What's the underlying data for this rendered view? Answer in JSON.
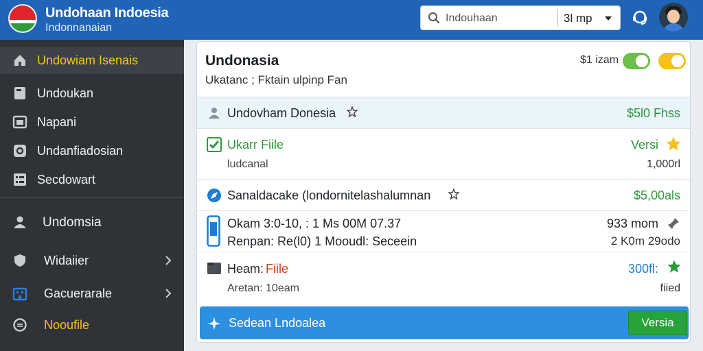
{
  "header": {
    "title": "Undohaan Indoesia",
    "subtitle": "Indonnanaian",
    "search": {
      "value": "Indouhaan",
      "selected": "3l mp"
    }
  },
  "sidebar": {
    "items": [
      {
        "label": "Undowiam Isenais",
        "icon": "home-icon",
        "active": true
      },
      {
        "label": "Undoukan",
        "icon": "document-icon"
      },
      {
        "label": "Napani",
        "icon": "image-icon"
      },
      {
        "label": "Undanfiadosian",
        "icon": "circle-icon"
      },
      {
        "label": "Secdowart",
        "icon": "list-icon"
      },
      {
        "label": "Undomsia",
        "icon": "user-icon"
      },
      {
        "label": "Widaiier",
        "icon": "shield-icon"
      },
      {
        "label": "Gacuerarale",
        "icon": "building-icon"
      },
      {
        "label": "Nooufile",
        "icon": "chat-icon"
      }
    ]
  },
  "main": {
    "title": "Undonasia",
    "subtitle": "Ukatanc ; Fktain ulpinp Fan",
    "status_label": "$1 izam",
    "rows": [
      {
        "title": "Undovham Donesia",
        "right": "$5l0 Fhss"
      },
      {
        "title": "Ukarr Fiile",
        "sub": "ludcanal",
        "right": "Versi",
        "right_sub": "1,000rl"
      },
      {
        "title": "Sanaldacake (londornitelashalumnan",
        "right": "$5,00als"
      },
      {
        "line1": "Okam 3:0-10, : 1 Ms 00M 07.37",
        "line2": "Renpan: Re(l0) 1 Mooudl: Seceein",
        "right1": "933 mom",
        "right2": "2 K0m 29odo"
      },
      {
        "title_a": "Heam:",
        "title_b": "Fiile",
        "sub": "Aretan: 10eam",
        "right": "300fl:",
        "right_sub": "fiied"
      }
    ],
    "banner": {
      "text": "Sedean Lndoalea",
      "button": "Versia"
    }
  },
  "colors": {
    "header_bg": "#1f64b7",
    "sidebar_bg": "#2f3338",
    "accent_blue": "#2d8fe0",
    "accent_green": "#27a33b",
    "accent_yellow": "#f4c21a"
  }
}
